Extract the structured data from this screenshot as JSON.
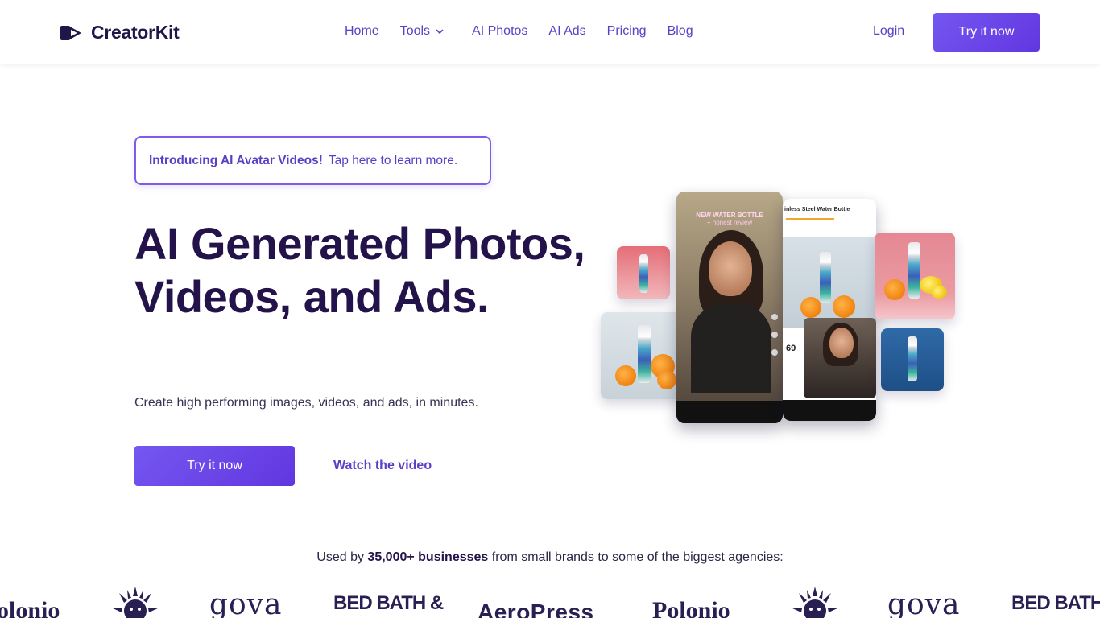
{
  "brand": {
    "name": "CreatorKit"
  },
  "nav": {
    "links": [
      {
        "label": "Home"
      },
      {
        "label": "Tools"
      },
      {
        "label": "AI Photos"
      },
      {
        "label": "AI Ads"
      },
      {
        "label": "Pricing"
      },
      {
        "label": "Blog"
      }
    ],
    "login": "Login",
    "cta": "Try it now"
  },
  "hero": {
    "announce_strong": "Introducing AI Avatar Videos!",
    "announce_rest": "Tap here to learn more.",
    "headline": "AI Generated Photos, Videos, and Ads.",
    "subheadline": "Create high performing images, videos, and ads, in minutes.",
    "cta_primary": "Try it now",
    "cta_secondary": "Watch the video"
  },
  "collage": {
    "video_caption_line1": "NEW WATER BOTTLE",
    "video_caption_line2": "+ honest review",
    "product_page_title": "inless Steel Water Bottle",
    "price_fragment": "69"
  },
  "trust": {
    "prefix": "Used by",
    "count": "35,000+ businesses",
    "suffix": "from small brands to some of the biggest agencies:",
    "logos": [
      "olonio",
      "gova",
      "BED BATH &",
      "AeroPress",
      "Polonio",
      "gova",
      "BED BATH &"
    ]
  },
  "colors": {
    "accent": "#6a45e8",
    "heading": "#24134a",
    "link": "#5b3fc7"
  }
}
